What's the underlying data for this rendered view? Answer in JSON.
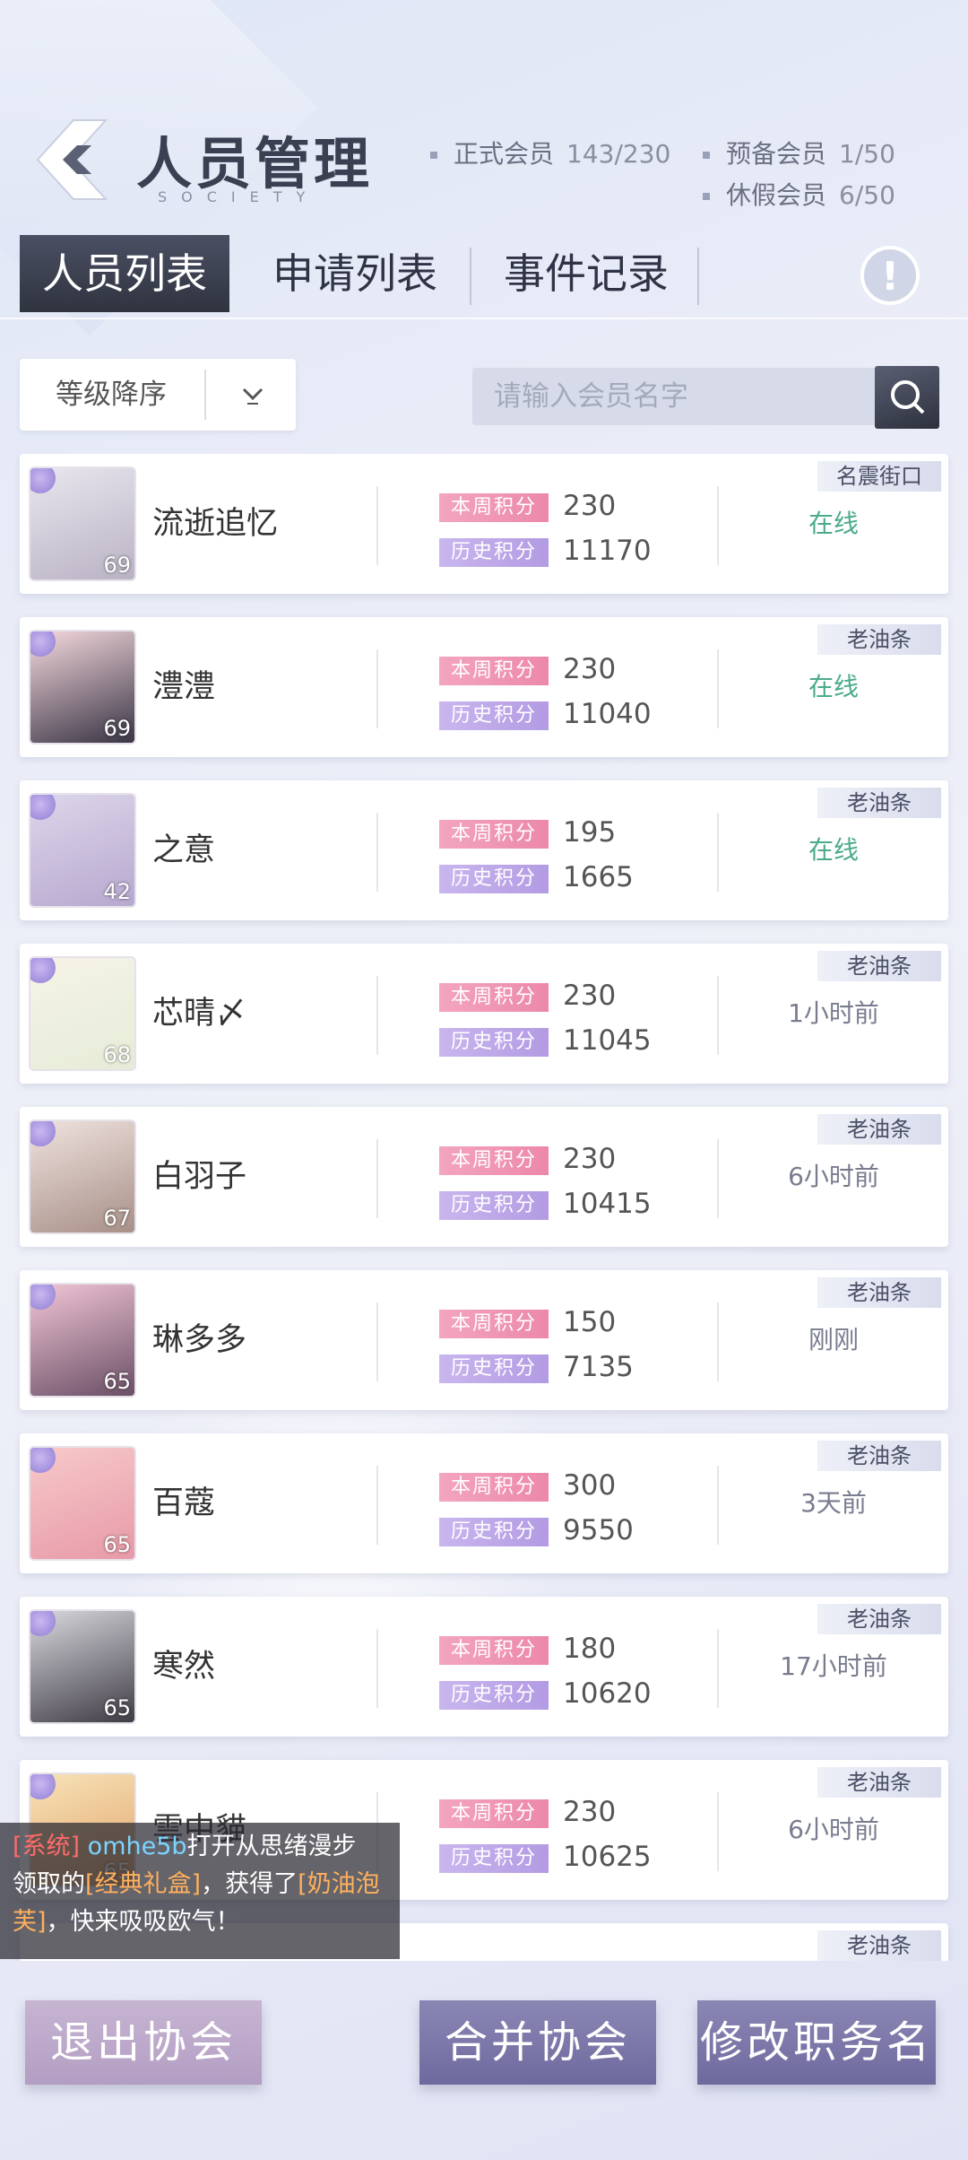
{
  "header": {
    "title": "人员管理",
    "subtitle": "SOCIETY",
    "stats": [
      {
        "label": "正式会员",
        "value": "143/230"
      },
      {
        "label": "预备会员",
        "value": "1/50"
      },
      {
        "label": "休假会员",
        "value": "6/50"
      }
    ]
  },
  "tabs": [
    {
      "label": "人员列表"
    },
    {
      "label": "申请列表"
    },
    {
      "label": "事件记录"
    }
  ],
  "controls": {
    "sort_label": "等级降序",
    "search_placeholder": "请输入会员名字"
  },
  "score_labels": {
    "week": "本周积分",
    "history": "历史积分"
  },
  "members": [
    {
      "name": "流逝追忆",
      "level": "69",
      "week": "230",
      "history": "11170",
      "status": "在线",
      "rank": "名震街口"
    },
    {
      "name": "澧澧",
      "level": "69",
      "week": "230",
      "history": "11040",
      "status": "在线",
      "rank": "老油条"
    },
    {
      "name": "之意",
      "level": "42",
      "week": "195",
      "history": "1665",
      "status": "在线",
      "rank": "老油条"
    },
    {
      "name": "芯晴〆",
      "level": "68",
      "week": "230",
      "history": "11045",
      "status": "1小时前",
      "rank": "老油条"
    },
    {
      "name": "白羽子",
      "level": "67",
      "week": "230",
      "history": "10415",
      "status": "6小时前",
      "rank": "老油条"
    },
    {
      "name": "琳多多",
      "level": "65",
      "week": "150",
      "history": "7135",
      "status": "刚刚",
      "rank": "老油条"
    },
    {
      "name": "百蔻",
      "level": "65",
      "week": "300",
      "history": "9550",
      "status": "3天前",
      "rank": "老油条"
    },
    {
      "name": "寒然",
      "level": "65",
      "week": "180",
      "history": "10620",
      "status": "17小时前",
      "rank": "老油条"
    },
    {
      "name": "雲中貓",
      "level": "65",
      "week": "230",
      "history": "10625",
      "status": "6小时前",
      "rank": "老油条"
    },
    {
      "name": "",
      "level": "",
      "week": "",
      "history": "",
      "status": "",
      "rank": "老油条"
    }
  ],
  "chat": {
    "system_tag": "[系统]",
    "user": "omhe5b",
    "text1": "打开从思绪漫步",
    "text2": "领取的",
    "item1": "[经典礼盒]",
    "text3": "，获得了",
    "item2": "[奶油泡芙]",
    "text4": "，快来吸吸欧气！"
  },
  "buttons": {
    "exit": "退出协会",
    "merge": "合并协会",
    "rename": "修改职务名"
  },
  "colors": {
    "online": "#4bab8b",
    "week_tag": "#ec88aa",
    "history_tag": "#b39be3",
    "button_primary": "#7c78aa"
  },
  "icons": [
    "back-arrow-icon",
    "alert-icon",
    "chevron-down-icon",
    "search-icon"
  ]
}
